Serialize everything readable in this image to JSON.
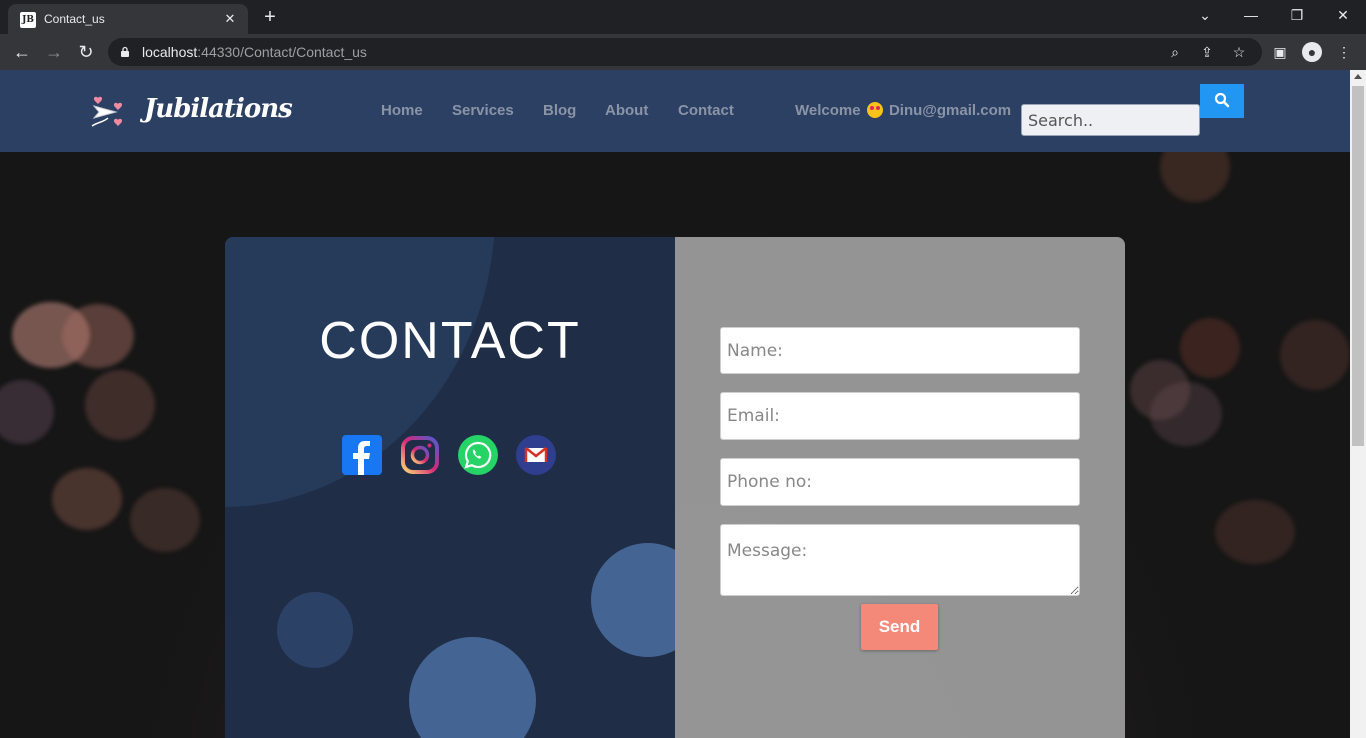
{
  "browser": {
    "tab_title": "Contact_us",
    "favicon_text": "JB",
    "url_host": "localhost",
    "url_path": ":44330/Contact/Contact_us"
  },
  "site": {
    "brand": "Jubilations",
    "nav": [
      "Home",
      "Services",
      "Blog",
      "About",
      "Contact"
    ],
    "welcome_prefix": "Welcome",
    "welcome_user": "Dinu@gmail.com",
    "search_placeholder": "Search.."
  },
  "contact": {
    "title": "CONTACT",
    "social": [
      "facebook-icon",
      "instagram-icon",
      "whatsapp-icon",
      "gmail-icon"
    ],
    "form": {
      "name_placeholder": "Name:",
      "email_placeholder": "Email:",
      "phone_placeholder": "Phone no:",
      "message_placeholder": "Message:",
      "send_label": "Send"
    }
  },
  "colors": {
    "nav_bg": "#2c4064",
    "card_left": "#1f2d47",
    "send_button": "#f4897a",
    "search_button": "#2196f3"
  }
}
